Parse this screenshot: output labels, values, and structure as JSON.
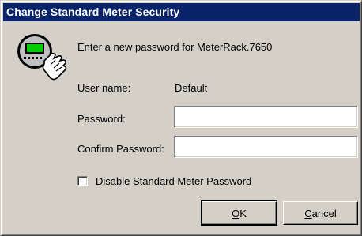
{
  "window": {
    "title": "Change Standard Meter Security"
  },
  "icon": {
    "name": "meter-with-hand-icon",
    "screen_color": "#00cc00"
  },
  "prompt": {
    "text": "Enter a new password for MeterRack.7650"
  },
  "form": {
    "username_label": "User name:",
    "username_value": "Default",
    "password_label": "Password:",
    "password_value": "",
    "confirm_label": "Confirm Password:",
    "confirm_value": ""
  },
  "disable_option": {
    "label": "Disable Standard Meter Password",
    "checked": false
  },
  "buttons": {
    "ok_mnemonic": "O",
    "ok_rest": "K",
    "cancel_mnemonic": "C",
    "cancel_rest": "ancel"
  },
  "colors": {
    "titlebar": "#0a246a",
    "dialog_face": "#d4d0c8"
  }
}
